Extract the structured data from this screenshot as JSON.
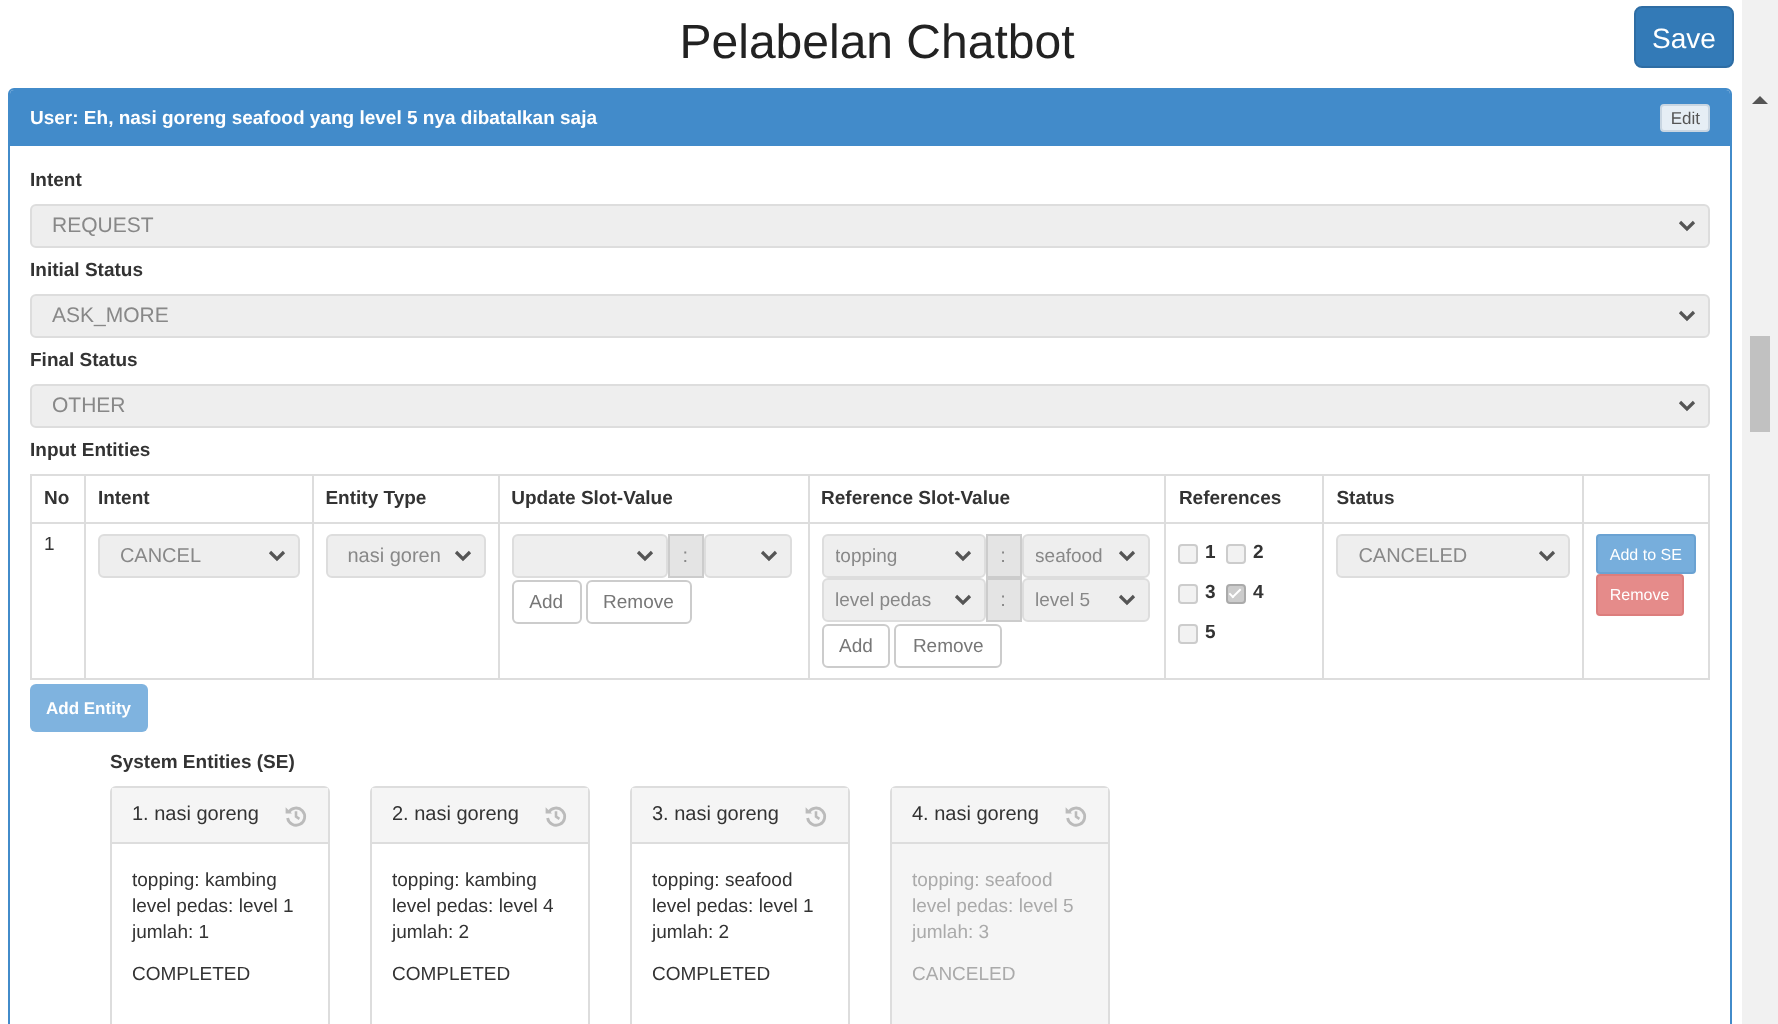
{
  "title": "Pelabelan Chatbot",
  "save_button": "Save",
  "utterance": {
    "speaker": "User:",
    "text": "Eh, nasi goreng seafood yang level 5 nya dibatalkan saja",
    "edit_button": "Edit"
  },
  "fields": [
    {
      "label": "Intent",
      "value": "REQUEST"
    },
    {
      "label": "Initial Status",
      "value": "ASK_MORE"
    },
    {
      "label": "Final Status",
      "value": "OTHER"
    }
  ],
  "input_entities": {
    "label": "Input Entities",
    "columns": [
      "No",
      "Intent",
      "Entity Type",
      "Update Slot-Value",
      "Reference Slot-Value",
      "References",
      "Status"
    ],
    "rows": [
      {
        "no": "1",
        "intent": "CANCEL",
        "entity_type": "nasi goren",
        "update_pairs": [
          {
            "separator": ":"
          }
        ],
        "update_add": "Add",
        "update_remove": "Remove",
        "reference_pairs": [
          {
            "slot": "topping",
            "separator": ":",
            "value": "seafood"
          },
          {
            "slot": "level pedas",
            "separator": ":",
            "value": "level 5"
          }
        ],
        "reference_add": "Add",
        "reference_remove": "Remove",
        "references": [
          {
            "label": "1",
            "checked": false
          },
          {
            "label": "2",
            "checked": false
          },
          {
            "label": "3",
            "checked": false
          },
          {
            "label": "4",
            "checked": true
          },
          {
            "label": "5",
            "checked": false
          }
        ],
        "status": "CANCELED",
        "add_to_se_button": "Add to SE",
        "remove_button": "Remove"
      }
    ]
  },
  "add_entity_button": "Add Entity",
  "system_entities": {
    "label": "System Entities (SE)",
    "cards": [
      {
        "title": "1. nasi goreng",
        "lines": [
          "topping: kambing",
          "level pedas: level 1",
          "jumlah: 1"
        ],
        "status": "COMPLETED",
        "disabled": false
      },
      {
        "title": "2. nasi goreng",
        "lines": [
          "topping: kambing",
          "level pedas: level 4",
          "jumlah: 2"
        ],
        "status": "COMPLETED",
        "disabled": false
      },
      {
        "title": "3. nasi goreng",
        "lines": [
          "topping: seafood",
          "level pedas: level 1",
          "jumlah: 2"
        ],
        "status": "COMPLETED",
        "disabled": false
      },
      {
        "title": "4. nasi goreng",
        "lines": [
          "topping: seafood",
          "level pedas: level 5",
          "jumlah: 3"
        ],
        "status": "CANCELED",
        "disabled": true
      }
    ]
  }
}
